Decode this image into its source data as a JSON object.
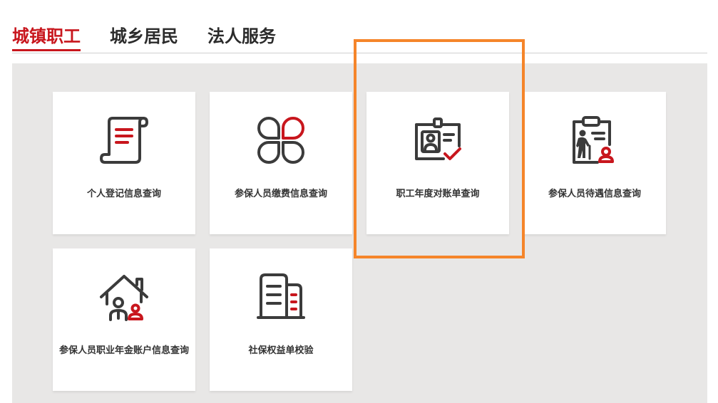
{
  "tabs": [
    {
      "label": "城镇职工",
      "active": true
    },
    {
      "label": "城乡居民",
      "active": false
    },
    {
      "label": "法人服务",
      "active": false
    }
  ],
  "services": [
    {
      "label": "个人登记信息查询",
      "icon": "document-scroll-icon"
    },
    {
      "label": "参保人员缴费信息查询",
      "icon": "clover-icon"
    },
    {
      "label": "职工年度对账单查询",
      "icon": "id-card-check-icon"
    },
    {
      "label": "参保人员待遇信息查询",
      "icon": "clipboard-elderly-icon"
    },
    {
      "label": "参保人员职业年金账户信息查询",
      "icon": "house-family-icon"
    },
    {
      "label": "社保权益单校验",
      "icon": "buildings-icon"
    }
  ],
  "colors": {
    "accent": "#c8161d",
    "icon_stroke": "#3b3b3b",
    "panel_bg": "#e8e7e6",
    "highlight": "#f5852a",
    "tab_text": "#2b2b2b"
  }
}
